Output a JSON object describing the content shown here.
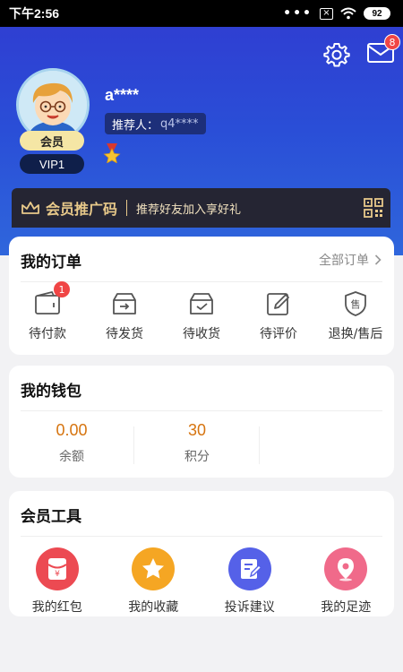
{
  "status_bar": {
    "time": "下午2:56",
    "dots": "•••",
    "sim": "×",
    "battery": "92"
  },
  "header": {
    "mail_badge": "8",
    "username": "a****",
    "referrer_label": "推荐人：",
    "referrer_code": "q4****",
    "member_tag": "会员",
    "vip_level": "VIP1",
    "promo_title": "会员推广码",
    "promo_desc": "推荐好友加入享好礼"
  },
  "orders": {
    "title": "我的订单",
    "all_label": "全部订单",
    "items": [
      {
        "label": "待付款",
        "icon": "wallet-icon",
        "badge": "1"
      },
      {
        "label": "待发货",
        "icon": "box-send-icon"
      },
      {
        "label": "待收货",
        "icon": "box-receive-icon"
      },
      {
        "label": "待评价",
        "icon": "edit-icon"
      },
      {
        "label": "退换/售后",
        "icon": "after-sales-shield-icon"
      }
    ]
  },
  "wallet": {
    "title": "我的钱包",
    "items": [
      {
        "value": "0.00",
        "label": "余额"
      },
      {
        "value": "30",
        "label": "积分"
      }
    ]
  },
  "tools": {
    "title": "会员工具",
    "items": [
      {
        "label": "我的红包",
        "icon": "red-envelope-icon",
        "color": "#ec4a52"
      },
      {
        "label": "我的收藏",
        "icon": "star-icon",
        "color": "#f5a623"
      },
      {
        "label": "投诉建议",
        "icon": "feedback-icon",
        "color": "#5561e8"
      },
      {
        "label": "我的足迹",
        "icon": "location-pin-icon",
        "color": "#f06a8a"
      }
    ]
  },
  "colors": {
    "header_top": "#2f3fd2",
    "header_bottom": "#2f66dc",
    "accent_orange": "#d6740f",
    "badge_red": "#f04545",
    "promo_gold": "#e8c98a"
  }
}
